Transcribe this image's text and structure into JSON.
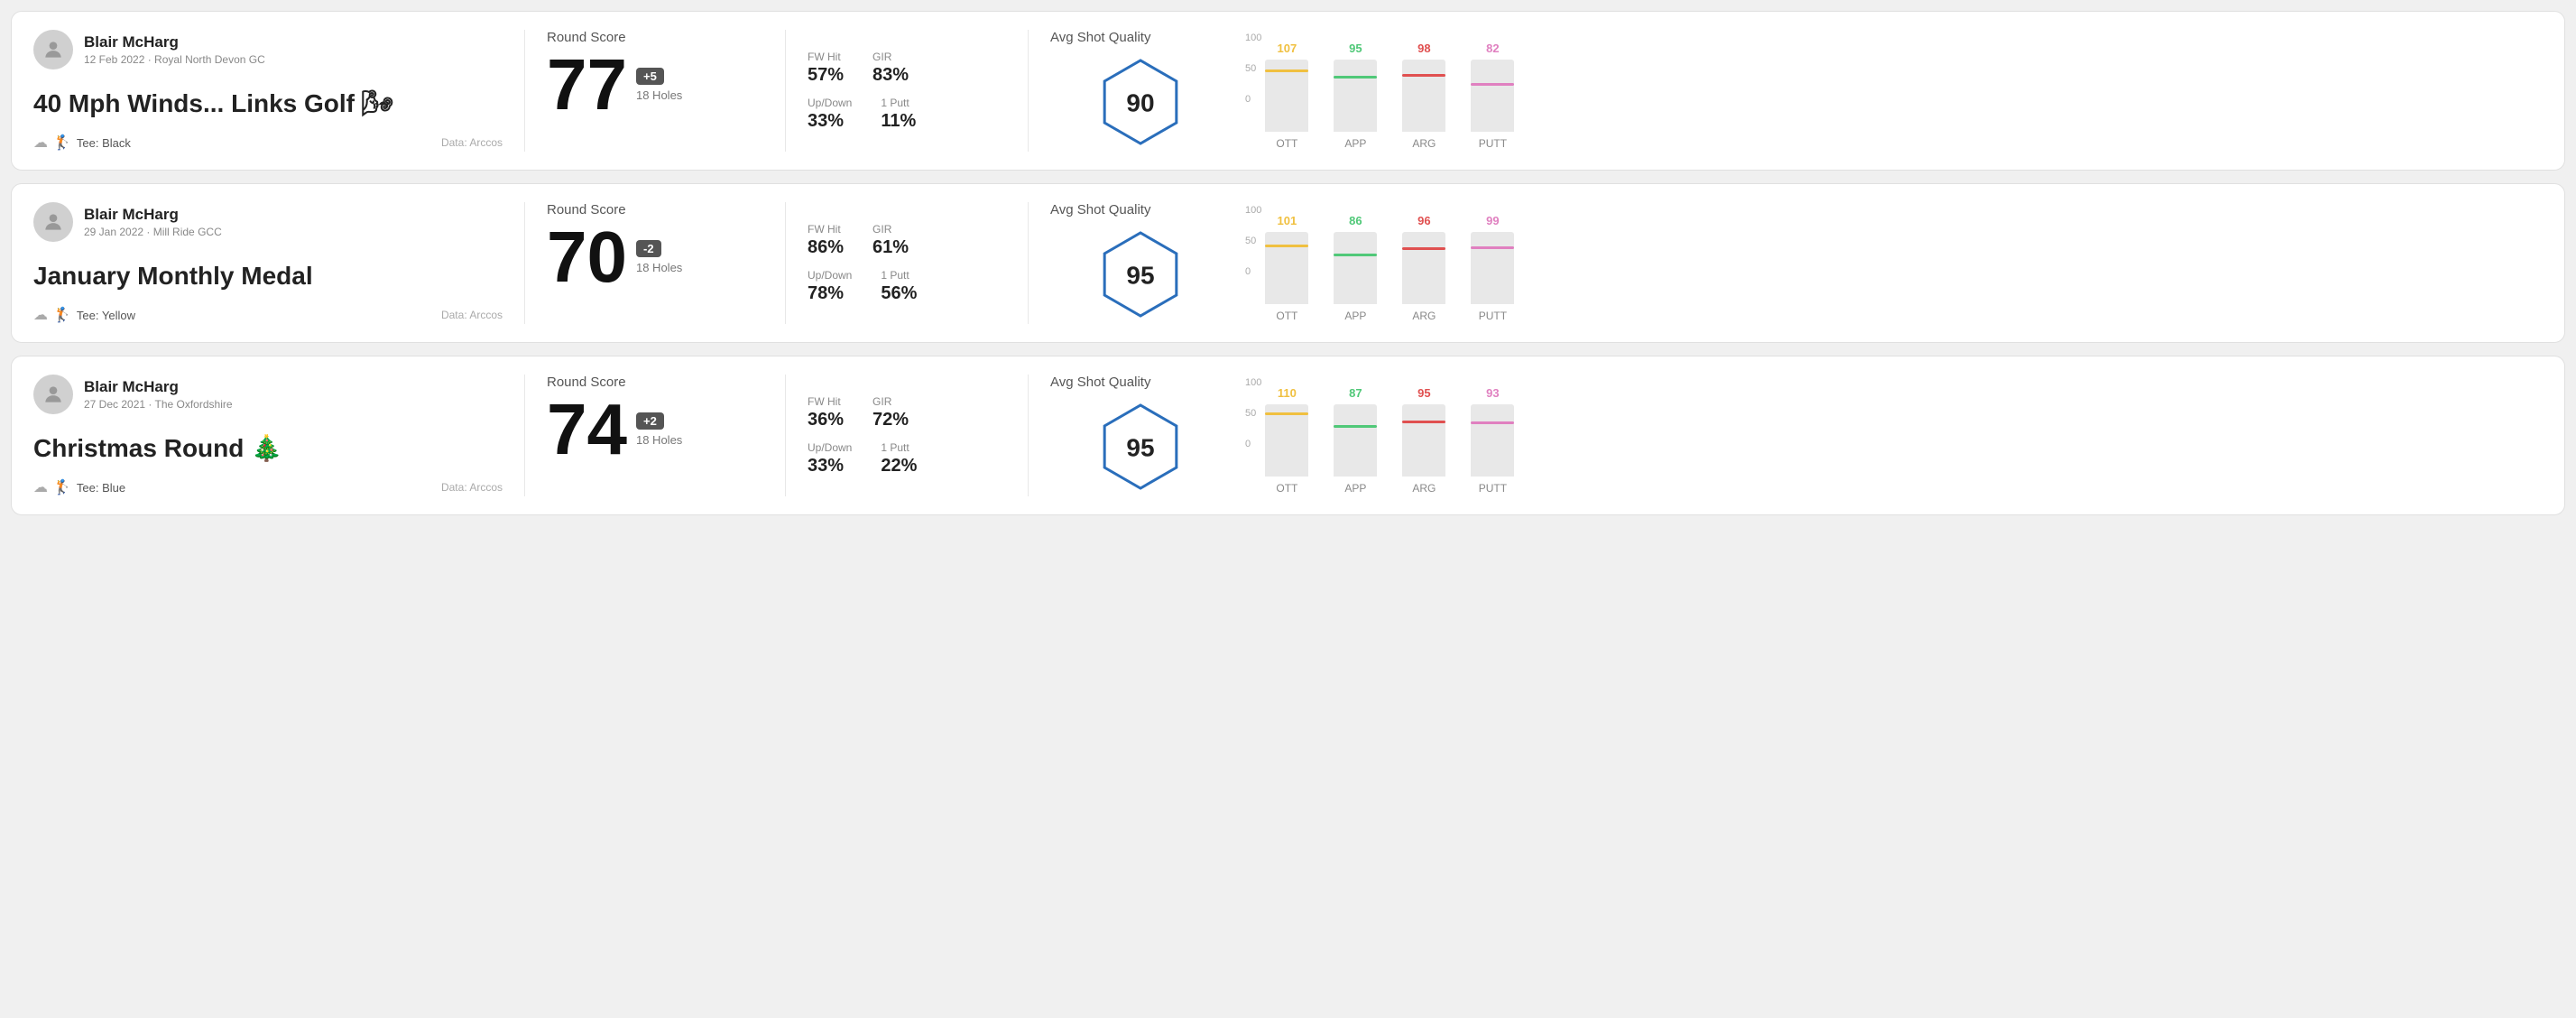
{
  "rounds": [
    {
      "id": "round1",
      "user_name": "Blair McHarg",
      "user_meta": "12 Feb 2022 · Royal North Devon GC",
      "title": "40 Mph Winds... Links Golf 🌬",
      "tee": "Black",
      "data_source": "Data: Arccos",
      "score": "77",
      "score_diff": "+5",
      "holes": "18 Holes",
      "fw_hit": "57%",
      "gir": "83%",
      "up_down": "33%",
      "one_putt": "11%",
      "avg_quality": "90",
      "chart_bars": [
        {
          "label": "OTT",
          "value": 107,
          "color": "#f0c040",
          "max": 130
        },
        {
          "label": "APP",
          "value": 95,
          "color": "#50c878",
          "max": 130
        },
        {
          "label": "ARG",
          "value": 98,
          "color": "#e05050",
          "max": 130
        },
        {
          "label": "PUTT",
          "value": 82,
          "color": "#e080c0",
          "max": 130
        }
      ]
    },
    {
      "id": "round2",
      "user_name": "Blair McHarg",
      "user_meta": "29 Jan 2022 · Mill Ride GCC",
      "title": "January Monthly Medal",
      "tee": "Yellow",
      "data_source": "Data: Arccos",
      "score": "70",
      "score_diff": "-2",
      "holes": "18 Holes",
      "fw_hit": "86%",
      "gir": "61%",
      "up_down": "78%",
      "one_putt": "56%",
      "avg_quality": "95",
      "chart_bars": [
        {
          "label": "OTT",
          "value": 101,
          "color": "#f0c040",
          "max": 130
        },
        {
          "label": "APP",
          "value": 86,
          "color": "#50c878",
          "max": 130
        },
        {
          "label": "ARG",
          "value": 96,
          "color": "#e05050",
          "max": 130
        },
        {
          "label": "PUTT",
          "value": 99,
          "color": "#e080c0",
          "max": 130
        }
      ]
    },
    {
      "id": "round3",
      "user_name": "Blair McHarg",
      "user_meta": "27 Dec 2021 · The Oxfordshire",
      "title": "Christmas Round 🎄",
      "tee": "Blue",
      "data_source": "Data: Arccos",
      "score": "74",
      "score_diff": "+2",
      "holes": "18 Holes",
      "fw_hit": "36%",
      "gir": "72%",
      "up_down": "33%",
      "one_putt": "22%",
      "avg_quality": "95",
      "chart_bars": [
        {
          "label": "OTT",
          "value": 110,
          "color": "#f0c040",
          "max": 130
        },
        {
          "label": "APP",
          "value": 87,
          "color": "#50c878",
          "max": 130
        },
        {
          "label": "ARG",
          "value": 95,
          "color": "#e05050",
          "max": 130
        },
        {
          "label": "PUTT",
          "value": 93,
          "color": "#e080c0",
          "max": 130
        }
      ]
    }
  ],
  "labels": {
    "round_score": "Round Score",
    "avg_shot_quality": "Avg Shot Quality",
    "fw_hit": "FW Hit",
    "gir": "GIR",
    "up_down": "Up/Down",
    "one_putt": "1 Putt",
    "tee_prefix": "Tee:",
    "y_100": "100",
    "y_50": "50",
    "y_0": "0"
  }
}
